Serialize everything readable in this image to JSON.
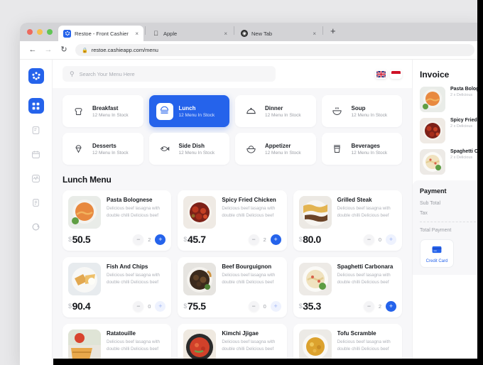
{
  "browser": {
    "tabs": [
      {
        "title": "Restoe - Front Cashier",
        "icon": "restoe-favicon",
        "close": "×",
        "active": true
      },
      {
        "title": "Apple",
        "icon": "apple-favicon",
        "close": "×",
        "active": false
      },
      {
        "title": "New Tab",
        "icon": "chrome-favicon",
        "close": "×",
        "active": false
      }
    ],
    "new_tab_label": "+",
    "nav": {
      "back": "←",
      "forward": "→",
      "reload": "↻",
      "lock": "🔒"
    },
    "url": "restoe.cashieapp.com/menu"
  },
  "rail": {
    "logo_icon": "restoe-logo-icon",
    "items": [
      {
        "icon": "grid-dashboard-icon",
        "active": true
      },
      {
        "icon": "note-edit-icon",
        "active": false
      },
      {
        "icon": "calendar-icon",
        "active": false
      },
      {
        "icon": "activity-chart-icon",
        "active": false
      },
      {
        "icon": "document-list-icon",
        "active": false
      },
      {
        "icon": "chat-bubble-icon",
        "active": false
      }
    ]
  },
  "topbar": {
    "search_placeholder": "Search Your Menu Here",
    "search_value": "",
    "search_icon": "search-icon",
    "flags": [
      {
        "name": "flag-uk",
        "label": "EN"
      },
      {
        "name": "flag-indonesia",
        "label": "ID"
      }
    ]
  },
  "categories": [
    {
      "name": "Breakfast",
      "stock": "12 Menu In Stock",
      "icon": "bread-icon",
      "active": false
    },
    {
      "name": "Lunch",
      "stock": "12 Menu In Stock",
      "icon": "burger-icon",
      "active": true
    },
    {
      "name": "Dinner",
      "stock": "12 Menu In Stock",
      "icon": "cloche-icon",
      "active": false
    },
    {
      "name": "Soup",
      "stock": "12 Menu In Stock",
      "icon": "soup-bowl-icon",
      "active": false
    },
    {
      "name": "Desserts",
      "stock": "12 Menu In Stock",
      "icon": "ice-cream-icon",
      "active": false
    },
    {
      "name": "Side Dish",
      "stock": "12 Menu In Stock",
      "icon": "fish-icon",
      "active": false
    },
    {
      "name": "Appetizer",
      "stock": "12 Menu In Stock",
      "icon": "salad-icon",
      "active": false
    },
    {
      "name": "Beverages",
      "stock": "12 Menu In Stock",
      "icon": "coffee-cup-icon",
      "active": false
    }
  ],
  "menu": {
    "section_title": "Lunch Menu",
    "currency": "$",
    "items": [
      {
        "name": "Pasta Bolognese",
        "desc": "Delicious beef lasagna with double chilli Delicious beef",
        "price": "50.5",
        "qty": "2",
        "plus_active": true,
        "thumb": "pasta-bolognese-photo"
      },
      {
        "name": "Spicy Fried Chicken",
        "desc": "Delicious beef lasagna with double chilli Delicious beef",
        "price": "45.7",
        "qty": "2",
        "plus_active": true,
        "thumb": "spicy-fried-chicken-photo"
      },
      {
        "name": "Grilled Steak",
        "desc": "Delicious beef lasagna with double chilli Delicious beef",
        "price": "80.0",
        "qty": "0",
        "plus_active": false,
        "thumb": "grilled-steak-photo"
      },
      {
        "name": "Fish And Chips",
        "desc": "Delicious beef lasagna with double chilli Delicious beef",
        "price": "90.4",
        "qty": "0",
        "plus_active": false,
        "thumb": "fish-and-chips-photo"
      },
      {
        "name": "Beef Bourguignon",
        "desc": "Delicious beef lasagna with double chilli Delicious beef",
        "price": "75.5",
        "qty": "0",
        "plus_active": false,
        "thumb": "beef-bourguignon-photo"
      },
      {
        "name": "Spaghetti Carbonara",
        "desc": "Delicious beef lasagna with double chilli Delicious beef",
        "price": "35.3",
        "qty": "2",
        "plus_active": true,
        "thumb": "spaghetti-carbonara-photo"
      },
      {
        "name": "Ratatouille",
        "desc": "Delicious beef lasagna with double chilli Delicious beef",
        "price": "",
        "qty": "",
        "plus_active": false,
        "thumb": "ratatouille-photo"
      },
      {
        "name": "Kimchi Jjigae",
        "desc": "Delicious beef lasagna with double chilli Delicious beef",
        "price": "",
        "qty": "",
        "plus_active": false,
        "thumb": "kimchi-jjigae-photo"
      },
      {
        "name": "Tofu Scramble",
        "desc": "Delicious beef lasagna with double chilli Delicious beef",
        "price": "",
        "qty": "",
        "plus_active": false,
        "thumb": "tofu-scramble-photo"
      }
    ]
  },
  "invoice": {
    "title": "Invoice",
    "items": [
      {
        "name": "Pasta Bolognese",
        "sub": "2 x Delicious",
        "thumb": "pasta-bolognese-photo"
      },
      {
        "name": "Spicy Fried Chicken",
        "sub": "2 x Delicious",
        "thumb": "spicy-fried-chicken-photo"
      },
      {
        "name": "Spaghetti Carbonara",
        "sub": "2 x Delicious",
        "thumb": "spaghetti-carbonara-photo"
      }
    ],
    "payment": {
      "title": "Payment",
      "sub_total_label": "Sub Total",
      "tax_label": "Tax",
      "total_label": "Total Payment",
      "methods": [
        {
          "label": "Credit Card",
          "icon": "credit-card-icon"
        }
      ]
    }
  }
}
